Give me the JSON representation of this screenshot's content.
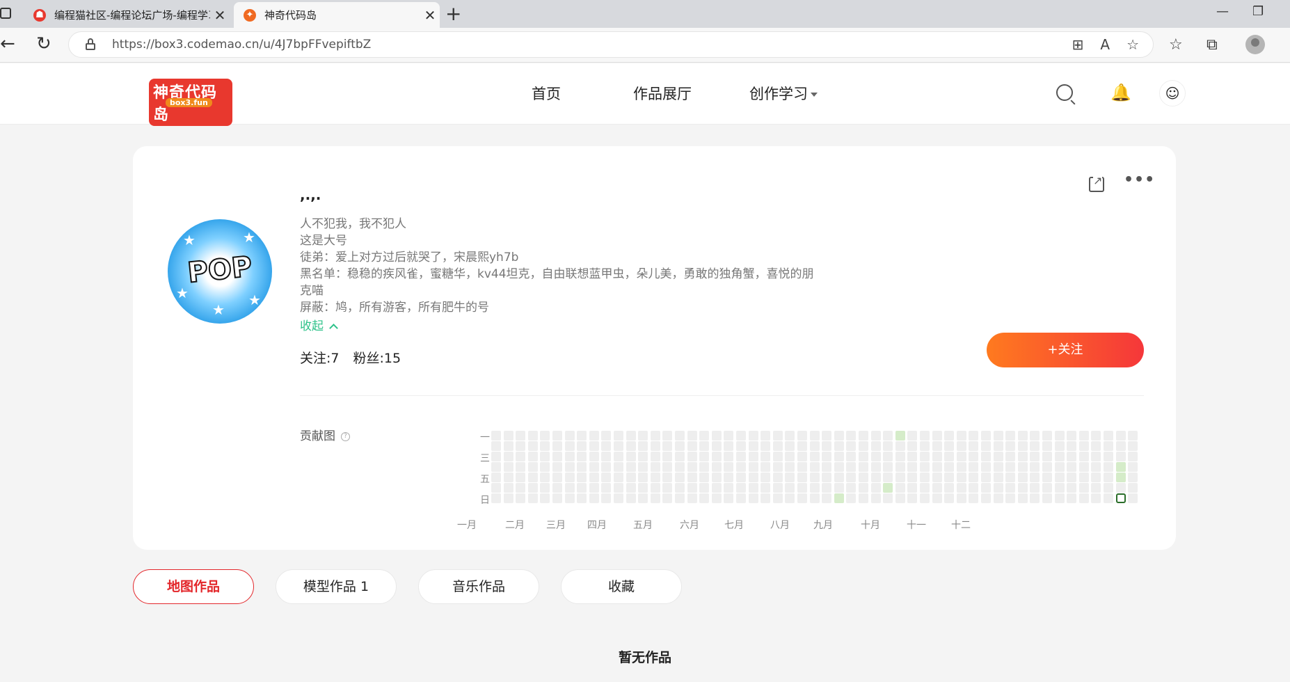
{
  "browser": {
    "tabs": [
      {
        "title": "编程猫社区-编程论坛广场-编程学习",
        "active": false
      },
      {
        "title": "神奇代码岛",
        "active": true
      }
    ],
    "new_tab_glyph": "+",
    "minimize_glyph": "—",
    "restore_glyph": "❐",
    "close_glyph": "✕",
    "url": "https://box3.codemao.cn/u/4J7bpFFvepiftbZ"
  },
  "site": {
    "logo_text": "神奇代码岛",
    "logo_sub": "box3.fun",
    "nav": [
      "首页",
      "作品展厅",
      "创作学习"
    ],
    "brand_color": "#e3262a"
  },
  "profile": {
    "username": ",.,.",
    "bio_lines": [
      "人不犯我，我不犯人",
      "这是大号",
      "徒弟：爱上对方过后就哭了，宋晨熙yh7b",
      "黑名单：稳稳的疾风雀，蜜糖华，kv44坦克，自由联想蓝甲虫，朵儿美，勇敢的独角蟹，喜悦的朋克喵",
      "屏蔽：鸠，所有游客，所有肥牛的号"
    ],
    "collapse_label": "收起",
    "following_label": "关注:7",
    "followers_label": "粉丝:15",
    "follow_button": "+关注",
    "avatar_text": "POP"
  },
  "contribution": {
    "label": "贡献图",
    "help_glyph": "?",
    "day_labels": [
      "一",
      "三",
      "五",
      "日"
    ],
    "months": [
      "一月",
      "二月",
      "三月",
      "四月",
      "五月",
      "六月",
      "七月",
      "八月",
      "九月",
      "十月",
      "十一",
      "十二"
    ],
    "weeks": 53,
    "active_cells": [
      {
        "week": 33,
        "day": 0,
        "level": 1
      },
      {
        "week": 28,
        "day": 6,
        "level": 1
      },
      {
        "week": 32,
        "day": 5,
        "level": 1
      },
      {
        "week": 51,
        "day": 3,
        "level": 1
      },
      {
        "week": 51,
        "day": 4,
        "level": 1
      }
    ],
    "today": {
      "week": 51,
      "day": 6
    },
    "active_color": "#d5ecc9",
    "today_color": "#2b6e2a"
  },
  "works_tabs": [
    {
      "label": "地图作品",
      "active": true
    },
    {
      "label": "模型作品 1",
      "active": false
    },
    {
      "label": "音乐作品",
      "active": false
    },
    {
      "label": "收藏",
      "active": false
    }
  ],
  "empty_text": "暂无作品"
}
